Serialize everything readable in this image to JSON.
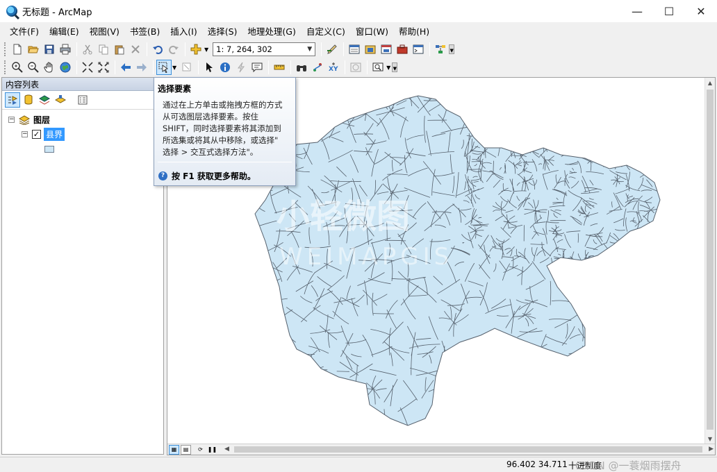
{
  "window": {
    "title": "无标题 - ArcMap",
    "minimize": "—",
    "maximize": "☐",
    "close": "✕"
  },
  "menu": {
    "items": [
      "文件(F)",
      "编辑(E)",
      "视图(V)",
      "书签(B)",
      "插入(I)",
      "选择(S)",
      "地理处理(G)",
      "自定义(C)",
      "窗口(W)",
      "帮助(H)"
    ]
  },
  "toolbar": {
    "scale": "1: 7, 264, 302"
  },
  "toc": {
    "title": "内容列表",
    "pin": "ᚹ",
    "group_label": "图层",
    "layer_label": "县界"
  },
  "tooltip": {
    "title": "选择要素",
    "body_lines": [
      "通过在上方单击或拖拽方框的方式",
      "从可选图层选择要素。按住",
      "SHIFT，同时选择要素将其添加到",
      "所选集或将其从中移除，或选择\"",
      "选择 > 交互式选择方法\"。"
    ],
    "help": "按 F1 获取更多帮助。"
  },
  "map": {
    "watermark_cn": "小轻微图",
    "watermark_en": "WEIMAPGIS",
    "fill_color": "#cde6f5",
    "stroke_color": "#55606c"
  },
  "status": {
    "coords": "96.402  34.711",
    "units": "十进制度",
    "credit": "CSDN @一蓑烟雨摆舟"
  }
}
